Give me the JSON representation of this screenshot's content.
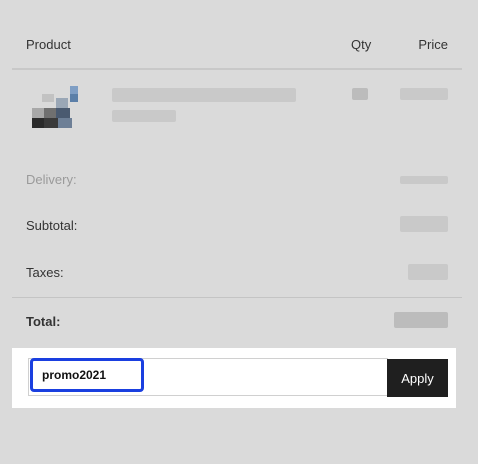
{
  "header": {
    "product_label": "Product",
    "qty_label": "Qty",
    "price_label": "Price"
  },
  "summary": {
    "delivery_label": "Delivery:",
    "subtotal_label": "Subtotal:",
    "taxes_label": "Taxes:",
    "total_label": "Total:"
  },
  "promo": {
    "code_value": "promo2021",
    "apply_label": "Apply"
  },
  "colors": {
    "background": "#dadada",
    "focus_ring": "#1a3fe0",
    "apply_button": "#1f1f1f"
  },
  "icons": {
    "product_thumbnail": "product-thumbnail-image"
  }
}
